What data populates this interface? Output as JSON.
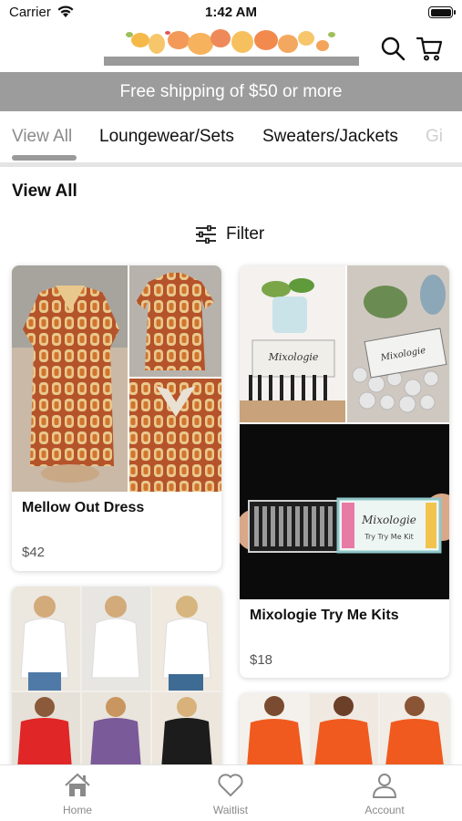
{
  "status_bar": {
    "carrier": "Carrier",
    "time": "1:42 AM"
  },
  "header": {
    "search_icon": "search-icon",
    "cart_icon": "cart-icon"
  },
  "promo": {
    "text": "Free shipping of $50 or more"
  },
  "tabs": [
    {
      "label": "View All",
      "active": true
    },
    {
      "label": "Loungewear/Sets",
      "active": false
    },
    {
      "label": "Sweaters/Jackets",
      "active": false
    },
    {
      "label": "Gi",
      "active": false
    }
  ],
  "section": {
    "title": "View All"
  },
  "filter": {
    "label": "Filter",
    "icon": "sliders-icon"
  },
  "products": [
    {
      "name": "Mellow Out Dress",
      "price": "$42"
    },
    {
      "name": "Mixologie Try Me Kits",
      "price": "$18"
    },
    {
      "name": "",
      "price": ""
    },
    {
      "name": "",
      "price": ""
    }
  ],
  "mixologie_label": {
    "brand": "Mixologie",
    "subtitle": "Try Try Me Kit"
  },
  "bottom_nav": [
    {
      "label": "Home",
      "icon": "home-icon"
    },
    {
      "label": "Waitlist",
      "icon": "heart-icon"
    },
    {
      "label": "Account",
      "icon": "person-icon"
    }
  ],
  "colors": {
    "promo_bg": "#9c9c9c",
    "accent_gray": "#9a9a9a",
    "dress_rust": "#b5532a",
    "orange_top": "#f05a1e"
  }
}
